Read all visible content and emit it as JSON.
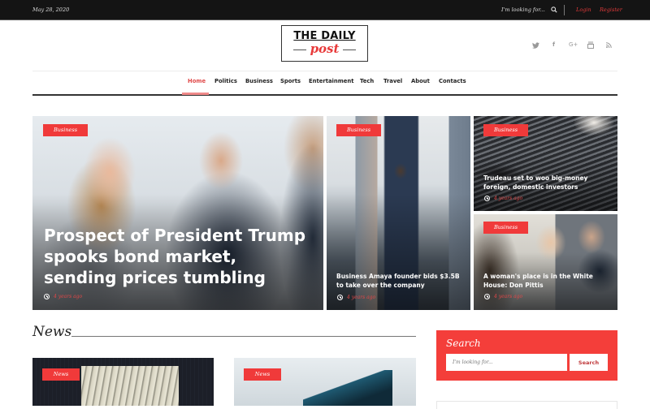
{
  "topbar": {
    "date": "May 28, 2020",
    "search_placeholder": "I'm looking for...",
    "search_icon": "search-icon",
    "login": "Login",
    "register": "Register"
  },
  "logo": {
    "line1": "THE DAILY",
    "line2": "post"
  },
  "social": [
    {
      "icon": "twitter-icon",
      "glyph": "🐦"
    },
    {
      "icon": "facebook-icon",
      "glyph": "f"
    },
    {
      "icon": "google-plus-icon",
      "glyph": "G+"
    },
    {
      "icon": "youtube-icon",
      "glyph": "▣"
    },
    {
      "icon": "rss-icon",
      "glyph": "〰"
    }
  ],
  "nav": {
    "items": [
      "Home",
      "Politics",
      "Business",
      "Sports",
      "Entertainment",
      "Tech",
      "Travel",
      "About",
      "Contacts"
    ],
    "active": "Home"
  },
  "featured": [
    {
      "category": "Business",
      "title": "Prospect of President Trump spooks bond market, sending prices tumbling",
      "time": "4 years ago"
    },
    {
      "category": "Business",
      "title": "Business Amaya founder bids $3.5B to take over the company",
      "time": "4 years ago"
    },
    {
      "category": "Business",
      "title": "Trudeau set to woo big-money foreign, domestic investors",
      "time": "4 years ago"
    },
    {
      "category": "Business",
      "title": "A woman's place is in the White House: Don Pittis",
      "time": "4 years ago"
    }
  ],
  "news_section": {
    "title": "News",
    "cards": [
      {
        "category": "News"
      },
      {
        "category": "News"
      }
    ]
  },
  "search_widget": {
    "title": "Search",
    "placeholder": "I'm looking for...",
    "button": "Search"
  },
  "colors": {
    "accent": "#f03a3a",
    "topbar": "#141414"
  }
}
